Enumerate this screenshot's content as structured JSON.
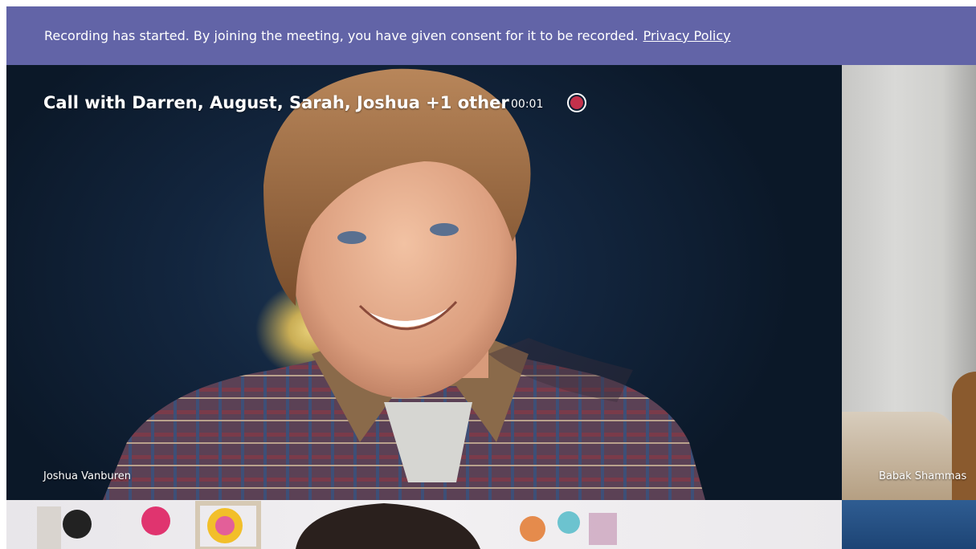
{
  "banner": {
    "message": "Recording has started. By joining the meeting, you have given consent for it to be recorded.",
    "privacy_link": "Privacy Policy",
    "color": "#6264a7"
  },
  "call": {
    "title": "Call with Darren, August, Sarah, Joshua +1 other",
    "timer": "00:01",
    "recording_icon": "record-icon",
    "recording_color": "#c4314b"
  },
  "participants": {
    "main": {
      "name": "Joshua Vanburen"
    },
    "side": {
      "name": "Babak Shammas"
    }
  }
}
